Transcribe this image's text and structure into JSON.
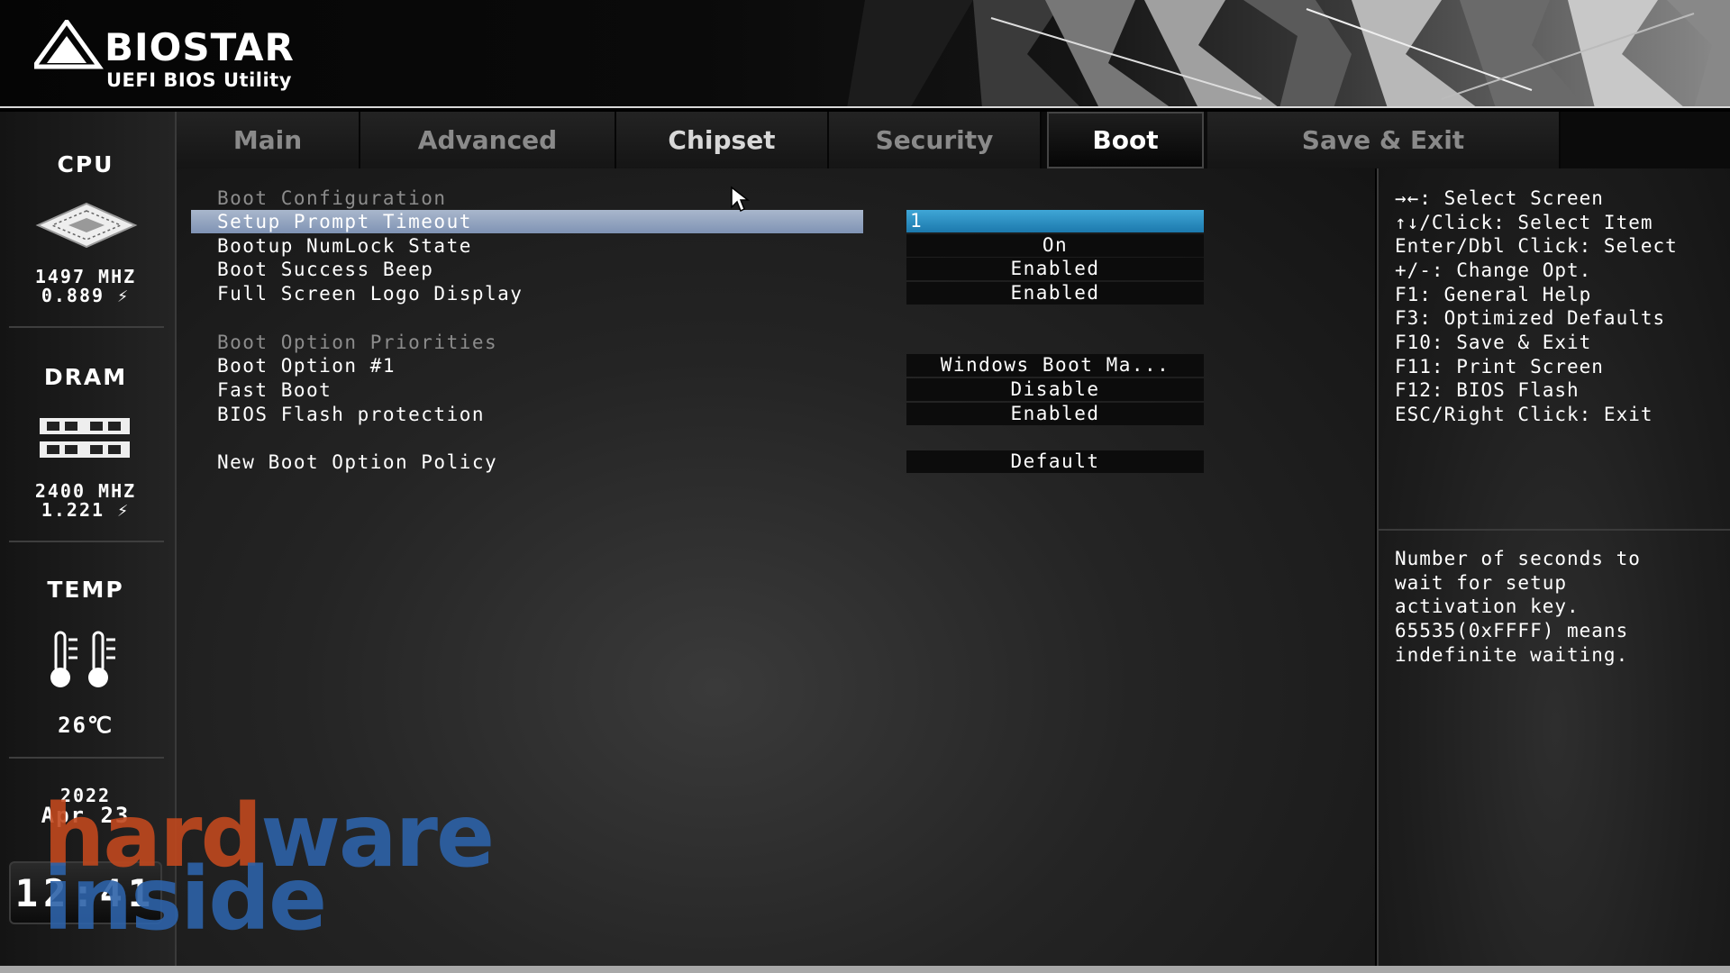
{
  "header": {
    "brand": "BIOSTAR",
    "subtitle": "UEFI BIOS Utility"
  },
  "tabs": [
    {
      "label": "Main"
    },
    {
      "label": "Advanced"
    },
    {
      "label": "Chipset"
    },
    {
      "label": "Security"
    },
    {
      "label": "Boot",
      "active": true
    },
    {
      "label": "Save & Exit"
    }
  ],
  "status": {
    "cpu": {
      "title": "CPU",
      "freq": "1497 MHZ",
      "volt": "0.889 ⚡"
    },
    "dram": {
      "title": "DRAM",
      "freq": "2400 MHZ",
      "volt": "1.221 ⚡"
    },
    "temp": {
      "title": "TEMP",
      "value": "26℃"
    },
    "date": {
      "year": "2022",
      "month_day": "Apr 23"
    },
    "clock": "12:41"
  },
  "boot": {
    "section_config": "Boot Configuration",
    "setup_prompt_timeout": {
      "label": "Setup Prompt Timeout",
      "value": "1"
    },
    "numlock": {
      "label": "Bootup NumLock State",
      "value": "On"
    },
    "success_beep": {
      "label": "Boot Success Beep",
      "value": "Enabled"
    },
    "logo_display": {
      "label": "Full Screen Logo Display",
      "value": "Enabled"
    },
    "section_priorities": "Boot Option Priorities",
    "boot_option_1": {
      "label": "Boot Option #1",
      "value": "Windows Boot Ma..."
    },
    "fast_boot": {
      "label": "Fast Boot",
      "value": "Disable"
    },
    "bios_flash_protection": {
      "label": "BIOS Flash protection",
      "value": "Enabled"
    },
    "new_boot_option_policy": {
      "label": "New Boot Option Policy",
      "value": "Default"
    }
  },
  "help": {
    "keys": [
      "→←: Select Screen",
      "↑↓/Click: Select Item",
      "Enter/Dbl Click: Select",
      "+/-: Change Opt.",
      "F1: General Help",
      "F3: Optimized Defaults",
      "F10: Save & Exit",
      "F11: Print Screen",
      "F12: BIOS Flash",
      "ESC/Right Click: Exit"
    ],
    "description": [
      "Number of seconds to",
      "wait for setup",
      "activation key.",
      "65535(0xFFFF) means",
      "indefinite waiting."
    ]
  },
  "watermark": {
    "line1_a": "hard",
    "line1_b": "ware",
    "line2": "inside"
  },
  "colors": {
    "highlight_row": "#8fa1bf",
    "selected_value": "#2a8fc6",
    "tab_active_text": "#ffffff",
    "watermark_orange": "#c0481e",
    "watermark_blue": "#2d62a8"
  }
}
